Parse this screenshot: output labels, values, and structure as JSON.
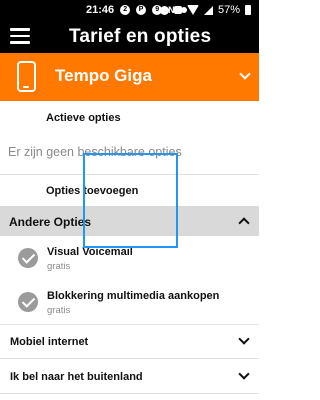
{
  "status_bar": {
    "time": "21:46",
    "notification_icons": [
      "2",
      "P",
      "9",
      "N"
    ],
    "battery_text": "57%"
  },
  "app_bar": {
    "title": "Tarief en opties"
  },
  "plan": {
    "name": "Tempo Giga"
  },
  "active_options": {
    "heading": "Actieve opties",
    "empty_message": "Er zijn geen beschikbare opties"
  },
  "add_options": {
    "label": "Opties toevoegen"
  },
  "other_options": {
    "heading": "Andere Opties",
    "items": [
      {
        "title": "Visual Voicemail",
        "subtitle": "gratis"
      },
      {
        "title": "Blokkering multimedia aankopen",
        "subtitle": "gratis"
      }
    ]
  },
  "rows": [
    {
      "label": "Mobiel internet"
    },
    {
      "label": "Ik bel naar het buitenland"
    }
  ],
  "colors": {
    "orange": "#ff7900",
    "black": "#000000",
    "section_gray": "#d9d9d9",
    "check_gray": "#9b9b9b",
    "overlay_blue": "#2196f3"
  }
}
